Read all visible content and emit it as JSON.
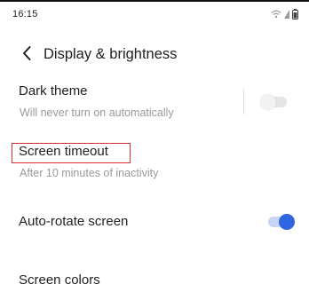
{
  "status_bar": {
    "time": "16:15",
    "icons": [
      "wifi-icon",
      "signal-icon",
      "battery-icon"
    ]
  },
  "header": {
    "back_icon": "chevron-left-icon",
    "title": "Display & brightness"
  },
  "settings": {
    "dark_theme": {
      "title": "Dark theme",
      "subtitle": "Will never turn on automatically",
      "toggle_state": "off"
    },
    "screen_timeout": {
      "title": "Screen timeout",
      "subtitle": "After 10 minutes of inactivity"
    },
    "auto_rotate": {
      "title": "Auto-rotate screen",
      "toggle_state": "on"
    },
    "screen_colors": {
      "title": "Screen colors"
    }
  },
  "colors": {
    "accent": "#2f66e0",
    "highlight_outline": "#d9302e"
  }
}
